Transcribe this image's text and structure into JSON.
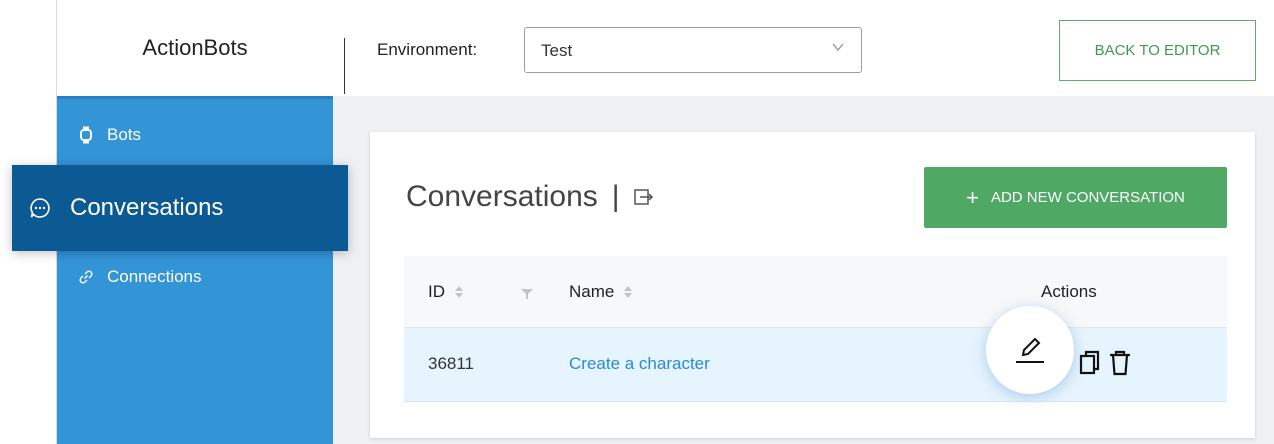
{
  "app": {
    "brand": "ActionBots"
  },
  "header": {
    "environment_label": "Environment:",
    "environment_value": "Test",
    "back_button": "BACK TO EDITOR"
  },
  "sidebar": {
    "items": [
      {
        "label": "Bots",
        "icon": "watch-icon"
      },
      {
        "label": "Conversations",
        "icon": "chat-bubble-icon",
        "active": true
      },
      {
        "label": "Connections",
        "icon": "link-icon"
      }
    ]
  },
  "main": {
    "title": "Conversations",
    "title_separator": "|",
    "add_button": "ADD NEW CONVERSATION",
    "add_button_icon": "plus-icon",
    "table": {
      "headers": {
        "id": "ID",
        "name": "Name",
        "actions": "Actions"
      },
      "rows": [
        {
          "id": "36811",
          "name": "Create a character"
        }
      ],
      "row_actions": [
        "edit-icon",
        "copy-icon",
        "trash-icon"
      ]
    }
  },
  "colors": {
    "sidebar": "#3394d6",
    "sidebar_active": "#0b5a94",
    "primary_green": "#4fa863",
    "link_blue": "#2a8ad8",
    "row_highlight": "#e6f4fd"
  }
}
